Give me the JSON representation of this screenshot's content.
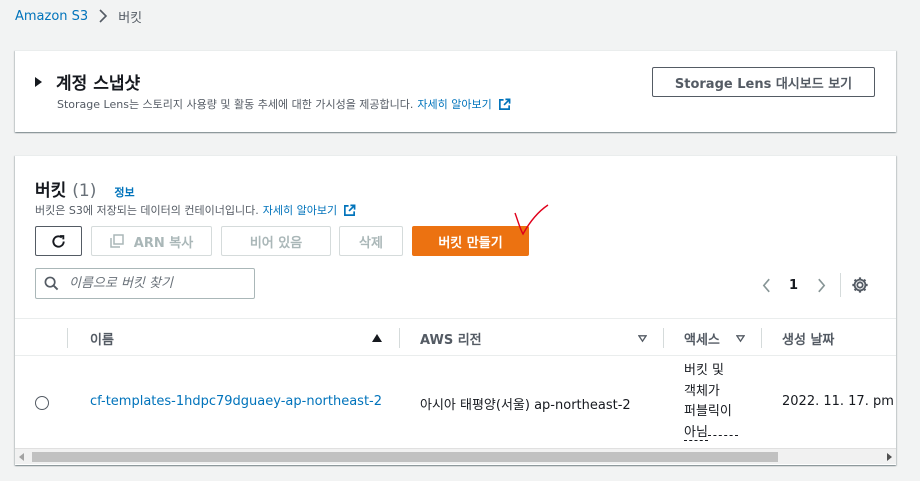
{
  "breadcrumb": {
    "root": "Amazon S3",
    "current": "버킷"
  },
  "snapshot": {
    "title": "계정 스냅샷",
    "description": "Storage Lens는 스토리지 사용량 및 활동 추세에 대한 가시성을 제공합니다.",
    "learn_more": "자세히 알아보기",
    "lens_button": "Storage Lens 대시보드 보기"
  },
  "buckets": {
    "title": "버킷",
    "count": "(1)",
    "info": "정보",
    "description": "버킷은 S3에 저장되는 데이터의 컨테이너입니다.",
    "learn_more": "자세히 알아보기",
    "actions": {
      "copy_arn": "ARN 복사",
      "empty": "비어 있음",
      "delete": "삭제",
      "create": "버킷 만들기"
    },
    "search_placeholder": "이름으로 버킷 찾기",
    "page": "1",
    "columns": {
      "name": "이름",
      "region": "AWS 리전",
      "access": "액세스",
      "created": "생성 날짜"
    },
    "rows": [
      {
        "name": "cf-templates-1hdpc79dguaey-ap-northeast-2",
        "region": "아시아 태평양(서울) ap-northeast-2",
        "access_lines": [
          "버킷 및",
          "객체가",
          "퍼블릭이",
          "아님"
        ],
        "created": "2022. 11. 17. pm"
      }
    ]
  },
  "colors": {
    "primary_button": "#ec7211",
    "link": "#0073bb",
    "annotation": "#e0001b"
  }
}
